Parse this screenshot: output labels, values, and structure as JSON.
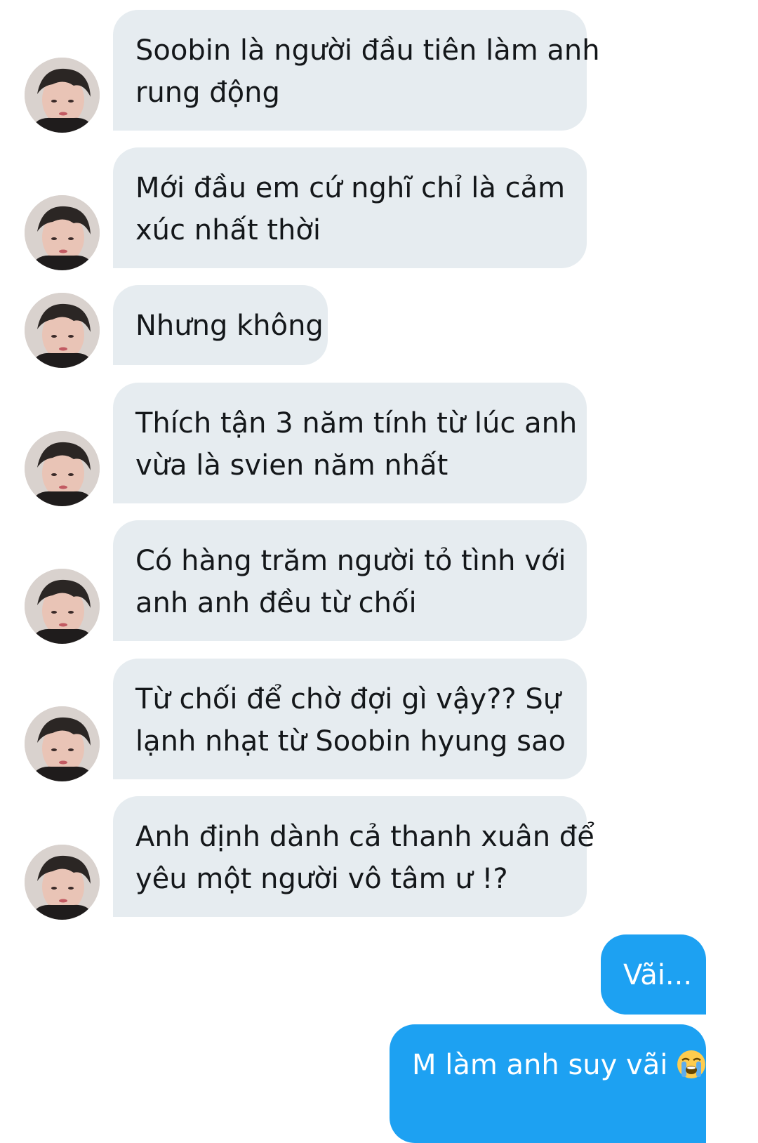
{
  "conversation": {
    "incoming": [
      {
        "lines": [
          "Soobin là người đầu tiên làm anh",
          "rung động"
        ]
      },
      {
        "lines": [
          "Mới đầu em cứ nghĩ chỉ là cảm",
          "xúc nhất thời"
        ]
      },
      {
        "lines": [
          "Nhưng không"
        ]
      },
      {
        "lines": [
          "Thích tận 3 năm tính từ lúc anh",
          "vừa là svien năm nhất"
        ]
      },
      {
        "lines": [
          "Có hàng trăm người tỏ tình với",
          "anh anh đều từ chối"
        ]
      },
      {
        "lines": [
          "Từ chối để chờ đợi gì vậy?? Sự",
          "lạnh nhạt từ Soobin hyung sao"
        ]
      },
      {
        "lines": [
          "Anh định dành cả thanh xuân để",
          "yêu một người vô tâm ư !?"
        ]
      }
    ],
    "outgoing": [
      {
        "text": "Vãi..."
      },
      {
        "text": "M làm anh suy vãi",
        "emoji": "loudly-crying-face-icon"
      }
    ]
  },
  "colors": {
    "incoming_bubble": "#e6ecf0",
    "incoming_text": "#14171a",
    "outgoing_bubble": "#1da1f2",
    "outgoing_text": "#ffffff"
  }
}
